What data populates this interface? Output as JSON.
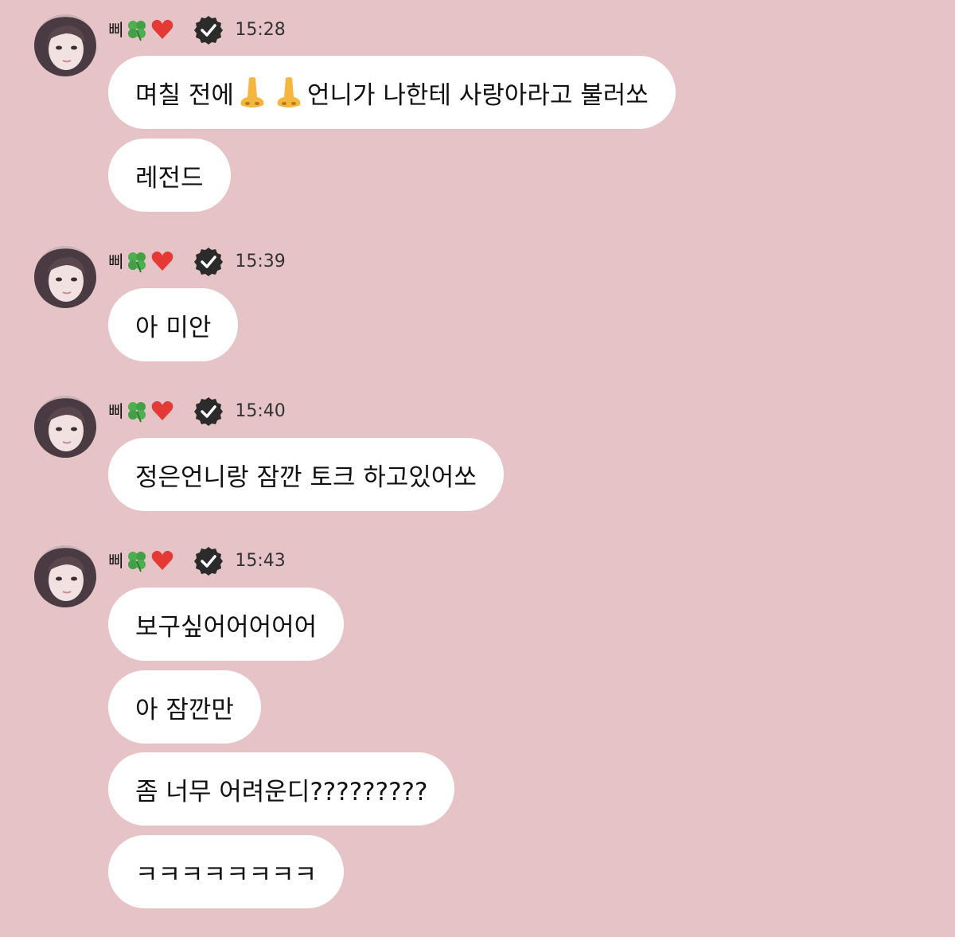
{
  "sender": {
    "name": "삐",
    "name_emojis": [
      "clover-icon",
      "heart-icon"
    ],
    "verified_icon": "verified-badge-icon"
  },
  "colors": {
    "background": "#e6c3c6",
    "bubble": "#ffffff",
    "text": "#111111"
  },
  "groups": [
    {
      "time": "15:28",
      "messages": [
        {
          "pre": "며칠 전에 ",
          "icons": [
            "nose-icon",
            "nose-icon"
          ],
          "post": "언니가 나한테 사랑아라고 불러쏘"
        },
        {
          "text": "레전드"
        }
      ]
    },
    {
      "time": "15:39",
      "messages": [
        {
          "text": "아 미안"
        }
      ]
    },
    {
      "time": "15:40",
      "messages": [
        {
          "text": "정은언니랑 잠깐 토크 하고있어쏘"
        }
      ]
    },
    {
      "time": "15:43",
      "messages": [
        {
          "text": "보구싶어어어어어"
        },
        {
          "text": "아 잠깐만"
        },
        {
          "text": "좀 너무 어려운디?????????"
        },
        {
          "text": "ㅋㅋㅋㅋㅋㅋㅋㅋ"
        }
      ]
    }
  ]
}
